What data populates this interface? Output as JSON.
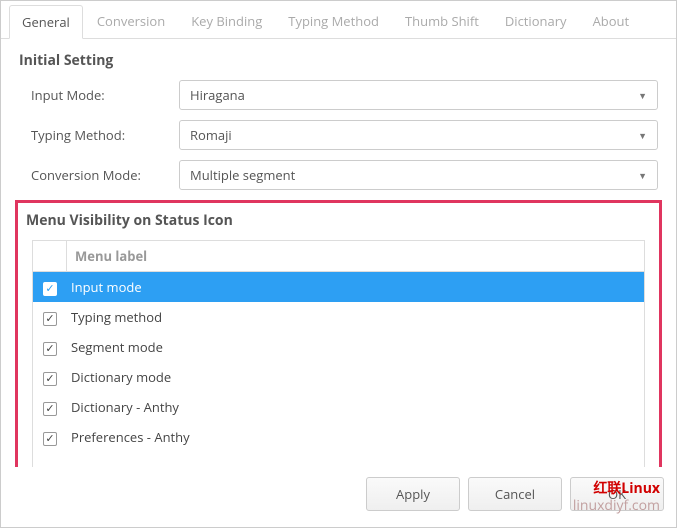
{
  "tabs": {
    "items": [
      {
        "label": "General",
        "active": true
      },
      {
        "label": "Conversion",
        "active": false
      },
      {
        "label": "Key Binding",
        "active": false
      },
      {
        "label": "Typing Method",
        "active": false
      },
      {
        "label": "Thumb Shift",
        "active": false
      },
      {
        "label": "Dictionary",
        "active": false
      },
      {
        "label": "About",
        "active": false
      }
    ]
  },
  "initial_setting": {
    "title": "Initial Setting",
    "input_mode_label": "Input Mode:",
    "input_mode_value": "Hiragana",
    "typing_method_label": "Typing Method:",
    "typing_method_value": "Romaji",
    "conversion_mode_label": "Conversion Mode:",
    "conversion_mode_value": "Multiple segment"
  },
  "menu_visibility": {
    "title": "Menu Visibility on Status Icon",
    "column_header": "Menu label",
    "rows": [
      {
        "label": "Input mode",
        "checked": true,
        "selected": true
      },
      {
        "label": "Typing method",
        "checked": true,
        "selected": false
      },
      {
        "label": "Segment mode",
        "checked": true,
        "selected": false
      },
      {
        "label": "Dictionary mode",
        "checked": true,
        "selected": false
      },
      {
        "label": "Dictionary - Anthy",
        "checked": true,
        "selected": false
      },
      {
        "label": "Preferences - Anthy",
        "checked": true,
        "selected": false
      }
    ]
  },
  "footer": {
    "apply": "Apply",
    "cancel": "Cancel",
    "ok": "OK"
  },
  "watermark": {
    "line1": "红联Linux",
    "line2": "linuxdiyf.com"
  }
}
